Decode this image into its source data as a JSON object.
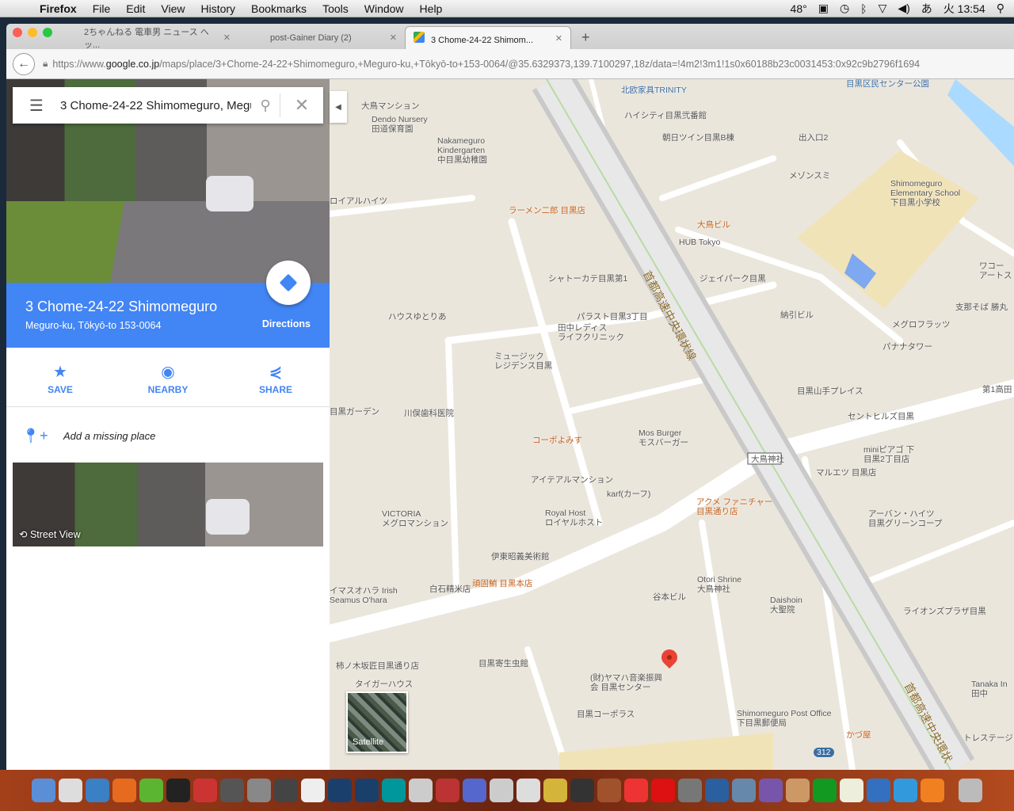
{
  "menubar": {
    "app": "Firefox",
    "items": [
      "File",
      "Edit",
      "View",
      "History",
      "Bookmarks",
      "Tools",
      "Window",
      "Help"
    ],
    "temp": "48°",
    "ime": "あ",
    "clock": "火 13:54"
  },
  "tabs": [
    {
      "title": "2ちゃんねる 電車男 ニュース ヘッ..."
    },
    {
      "title": "post-Gainer Diary (2)"
    },
    {
      "title": "3 Chome-24-22 Shimom..."
    }
  ],
  "url": {
    "prefix": "https://www.",
    "domain": "google.co.jp",
    "rest": "/maps/place/3+Chome-24-22+Shimomeguro,+Meguro-ku,+Tōkyō-to+153-0064/@35.6329373,139.7100297,18z/data=!4m2!3m1!1s0x60188b23c0031453:0x92c9b2796f1694"
  },
  "panel": {
    "search_value": "3 Chome-24-22 Shimomeguro, Meguro-ku",
    "title": "3 Chome-24-22 Shimomeguro",
    "subtitle": "Meguro-ku, Tōkyō-to 153-0064",
    "directions": "Directions",
    "actions": [
      "SAVE",
      "NEARBY",
      "SHARE"
    ],
    "add_place": "Add a missing place",
    "street_view": "Street View"
  },
  "map": {
    "satellite": "Satellite",
    "labels": [
      "大鳥マンション",
      "Dendo Nursery\n田道保育園",
      "Nakameguro\nKindergarten\n中目黒幼稚園",
      "北欧家具TRINITY",
      "ハイシティ目黒弐番館",
      "朝日ツイン目黒B棟",
      "出入口2",
      "目黒区民センター公園",
      "メゾンスミ",
      "Shimomeguro\nElementary School\n下目黒小学校",
      "ラーメン二郎 目黒店",
      "ロイアルハイツ",
      "大鳥ビル",
      "HUB Tokyo",
      "シャトーカテ目黒第1",
      "ジェイパーク目黒",
      "パラスト目黒3丁目",
      "田中レディス\nライフクリニック",
      "ハウスゆとりあ",
      "納引ビル",
      "メグロフラッツ",
      "パナナタワー",
      "支那そば 勝丸",
      "ワコー\nアートス",
      "ミュージック\nレジデンス目黒",
      "目黒山手プレイス",
      "第1高田",
      "目黒ガーデン",
      "川俣歯科医院",
      "セントヒルズ目黒",
      "コーポよみす",
      "Mos Burger\nモスバーガー",
      "miniピアゴ 下\n目黒2丁目店",
      "大鳥神社",
      "マルエツ 目黒店",
      "アイテアルマンション",
      "karf(カーフ)",
      "アクメ ファニチャー\n目黒通り店",
      "Royal Host\nロイヤルホスト",
      "VICTORIA\nメグロマンション",
      "アーバン・ハイツ\n目黒グリーンコープ",
      "伊東昭義美術館",
      "Otori Shrine\n大鳥神社",
      "白石精米店",
      "頑固鮹 目黒本店",
      "谷本ビル",
      "Daishoin\n大聖院",
      "イマスオハラ Irish\nSeamus O'hara",
      "ライオンズプラザ目黒",
      "柿ノ木坂匠目黒通り店",
      "目黒寄生虫館",
      "タイガーハウス",
      "(財)ヤマハ音楽振興\n会 目黒センター",
      "目黒コーポラス",
      "Shimomeguro Post Office\n下目黒郵便局",
      "かづ屋",
      "Tanaka In\n田中",
      "トレステージ目",
      "312"
    ],
    "highway": "首都高速中央環状線",
    "highway2": "首都高速中央環状"
  },
  "dock": {
    "count": 34
  }
}
